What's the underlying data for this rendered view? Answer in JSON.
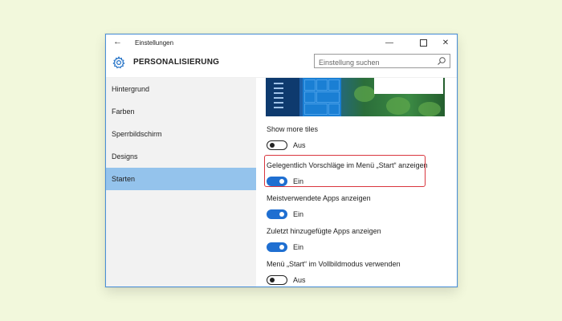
{
  "window": {
    "title": "Einstellungen",
    "back_icon": "back-arrow-icon",
    "minimize_icon": "minimize-icon",
    "maximize_icon": "maximize-icon",
    "close_icon": "close-icon"
  },
  "header": {
    "icon": "gear-icon",
    "title": "PERSONALISIERUNG",
    "search_placeholder": "Einstellung suchen",
    "search_icon": "search-icon"
  },
  "sidebar": {
    "items": [
      {
        "label": "Hintergrund",
        "active": false
      },
      {
        "label": "Farben",
        "active": false
      },
      {
        "label": "Sperrbildschirm",
        "active": false
      },
      {
        "label": "Designs",
        "active": false
      },
      {
        "label": "Starten",
        "active": true
      }
    ]
  },
  "settings": [
    {
      "label": "Show more tiles",
      "on": false,
      "state": "Aus"
    },
    {
      "label": "Gelegentlich Vorschläge im Menü „Start“ anzeigen",
      "on": true,
      "state": "Ein",
      "highlighted": true
    },
    {
      "label": "Meistverwendete Apps anzeigen",
      "on": true,
      "state": "Ein"
    },
    {
      "label": "Zuletzt hinzugefügte Apps anzeigen",
      "on": true,
      "state": "Ein"
    },
    {
      "label": "Menü „Start“ im Vollbildmodus verwenden",
      "on": false,
      "state": "Aus"
    }
  ],
  "colors": {
    "accent": "#1f6fd1",
    "active_nav": "#94c3ec",
    "highlight_border": "#d9363e",
    "page_background": "#f2f8dc"
  }
}
